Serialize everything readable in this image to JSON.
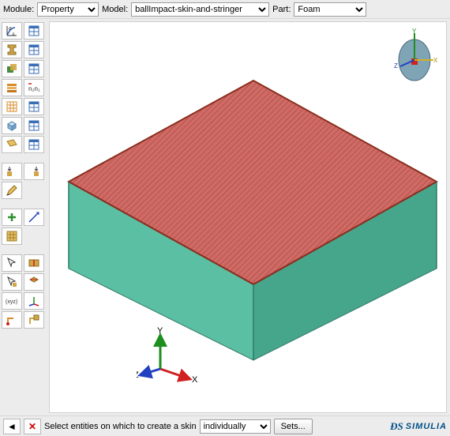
{
  "top": {
    "module_label": "Module:",
    "model_label": "Model:",
    "part_label": "Part:",
    "module_value": "Property",
    "model_value": "ballImpact-skin-and-stringer",
    "part_value": "Foam"
  },
  "toolbox": {
    "rows": [
      [
        "stress-strain-icon",
        "data-table-material-icon"
      ],
      [
        "i-beam-section-icon",
        "data-table-section-icon"
      ],
      [
        "section-assign-icon",
        "data-table-assignment-icon"
      ],
      [
        "composite-layup-icon",
        "node-numbers-icon"
      ],
      [
        "mesh-grid-icon",
        "data-table-orient-icon"
      ],
      [
        "cube-render-icon",
        "data-table-element-icon"
      ],
      [
        "profile-plane-icon",
        "data-table-profile-icon"
      ],
      [],
      [
        "insert-before-icon",
        "insert-after-icon"
      ],
      [
        "edit-sketch-icon"
      ],
      [],
      [
        "add-plus-icon",
        "measure-icon"
      ],
      [
        "mesh-seed-icon"
      ],
      [],
      [
        "select-arrow-icon",
        "partition-icon"
      ],
      [
        "select-face-icon",
        "partition-cell-icon"
      ],
      [
        "xyz-csys-icon",
        "triad-select-icon"
      ],
      [
        "align-corner-icon",
        "corner-partition-icon"
      ]
    ]
  },
  "axes": {
    "x": "X",
    "y": "Y",
    "z": "Z"
  },
  "bottom": {
    "back": "◄",
    "cancel": "✕",
    "prompt": "Select entities on which to create a skin",
    "mode": "individually",
    "sets": "Sets..."
  },
  "brand": {
    "ds": "ƉS",
    "name": "SIMULIA"
  },
  "icon_colors": {
    "table": "#3b6db5",
    "section": "#d2a646",
    "assign": "#4a8a3f",
    "mesh": "#d88c2a",
    "cube_top": "#cbe2f2",
    "cube_front": "#8fb7d8",
    "plus": "#2c8f2c",
    "arrow_sel": "#2c8f2c",
    "x": "#d02020",
    "y": "#1e8e1e",
    "z": "#2040c0",
    "triad_body": "#7fa4b6",
    "triad_square": "#d02020"
  },
  "block": {
    "top_fill": "#cf6a65",
    "top_hatch": "#9c3f3a",
    "front": "#5bbfa4",
    "side": "#45a68c",
    "edge": "#8a2e1e"
  }
}
